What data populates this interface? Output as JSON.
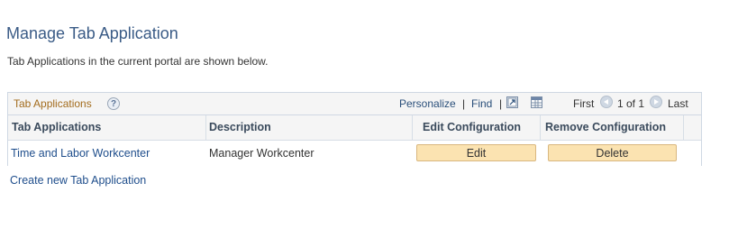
{
  "page": {
    "title": "Manage Tab Application",
    "intro": "Tab Applications in the current portal are shown below."
  },
  "grid": {
    "title": "Tab Applications",
    "help_icon": "help-question-icon",
    "toolbar": {
      "personalize": "Personalize",
      "sep1": "|",
      "find": "Find",
      "sep2": "|",
      "zoom_icon": "zoom-grid-icon",
      "download_icon": "download-spreadsheet-icon",
      "first": "First",
      "prev_icon": "previous-arrow-icon",
      "range": "1 of 1",
      "next_icon": "next-arrow-icon",
      "last": "Last"
    },
    "columns": [
      "Tab Applications",
      "Description",
      "Edit Configuration",
      "Remove Configuration"
    ],
    "rows": [
      {
        "name": "Time and Labor Workcenter",
        "description": "Manager Workcenter",
        "edit_label": "Edit",
        "delete_label": "Delete"
      }
    ]
  },
  "footer": {
    "create_link": "Create new Tab Application"
  },
  "colors": {
    "title": "#3a5b86",
    "grid_title": "#a36c1d",
    "link": "#1f4e8c",
    "button_bg": "#fbe3b1"
  }
}
